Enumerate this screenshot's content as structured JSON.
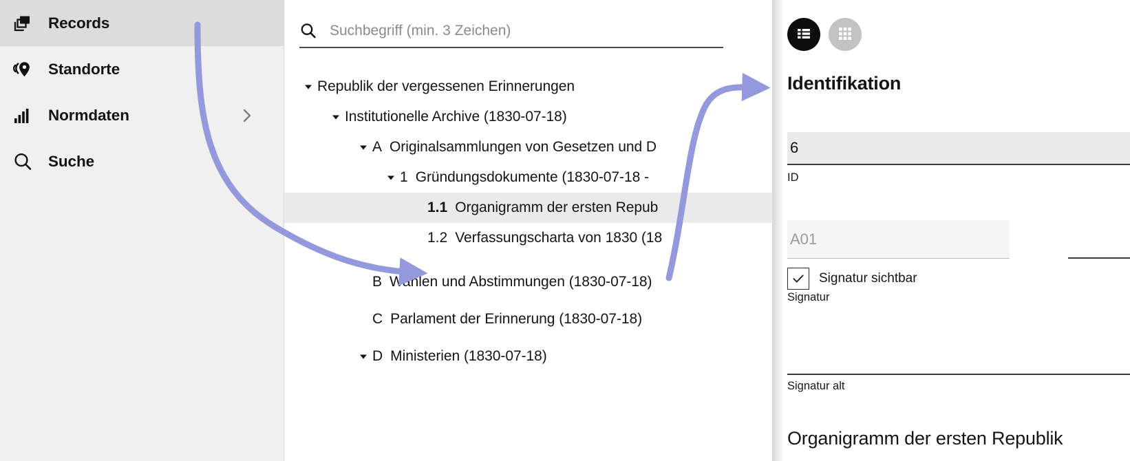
{
  "sidebar": {
    "items": [
      {
        "label": "Records",
        "icon": "records-icon",
        "active": true,
        "chevron": false
      },
      {
        "label": "Standorte",
        "icon": "location-icon",
        "active": false,
        "chevron": false
      },
      {
        "label": "Normdaten",
        "icon": "bars-icon",
        "active": false,
        "chevron": true
      },
      {
        "label": "Suche",
        "icon": "search-icon",
        "active": false,
        "chevron": false
      }
    ]
  },
  "tree_panel": {
    "search": {
      "placeholder": "Suchbegriff (min. 3 Zeichen)",
      "value": "",
      "icon": "search-icon"
    },
    "rows": [
      {
        "indent": 0,
        "twisty": "down",
        "ref": "",
        "label": "Republik der vergessenen Erinnerungen",
        "selected": false
      },
      {
        "indent": 1,
        "twisty": "down",
        "ref": "",
        "label": "Institutionelle Archive (1830-07-18)",
        "selected": false
      },
      {
        "indent": 2,
        "twisty": "down",
        "ref": "A",
        "label": "Originalsammlungen von Gesetzen und D",
        "selected": false
      },
      {
        "indent": 3,
        "twisty": "down",
        "ref": "1",
        "label": "Gründungsdokumente (1830-07-18 -",
        "selected": false
      },
      {
        "indent": 4,
        "twisty": "none",
        "ref": "1.1",
        "label": "Organigramm der ersten Repub",
        "selected": true
      },
      {
        "indent": 4,
        "twisty": "none",
        "ref": "1.2",
        "label": "Verfassungscharta von 1830 (18",
        "selected": false
      },
      {
        "indent": 2,
        "twisty": "none",
        "ref": "B",
        "label": "Wahlen und Abstimmungen (1830-07-18)",
        "selected": false
      },
      {
        "indent": 2,
        "twisty": "none",
        "ref": "C",
        "label": "Parlament der Erinnerung (1830-07-18)",
        "selected": false
      },
      {
        "indent": 2,
        "twisty": "down",
        "ref": "D",
        "label": "Ministerien (1830-07-18)",
        "selected": false
      }
    ]
  },
  "detail_panel": {
    "view_toggles": [
      {
        "name": "list-view",
        "icon": "list-icon",
        "active": true
      },
      {
        "name": "grid-view",
        "icon": "grid-icon",
        "active": false
      }
    ],
    "section_title": "Identifikation",
    "fields": {
      "id": {
        "label": "ID",
        "value": "6",
        "placeholder": ""
      },
      "signatur": {
        "label": "Signatur",
        "value": "",
        "placeholder": "A01"
      },
      "signatur_visible": {
        "label": "Signatur sichtbar",
        "checked": true
      },
      "signatur_alt": {
        "label": "Signatur alt",
        "value": ""
      }
    },
    "record_title": "Organigramm der ersten Republik"
  },
  "annotations": {
    "arrow_color": "#9499dd",
    "arrows": [
      {
        "name": "arrow-to-selected-row",
        "from": "records-sidebar",
        "to": "tree-row-1.1"
      },
      {
        "name": "arrow-to-identifikation",
        "from": "tree-row-1.1",
        "to": "identifikation-heading"
      }
    ]
  }
}
